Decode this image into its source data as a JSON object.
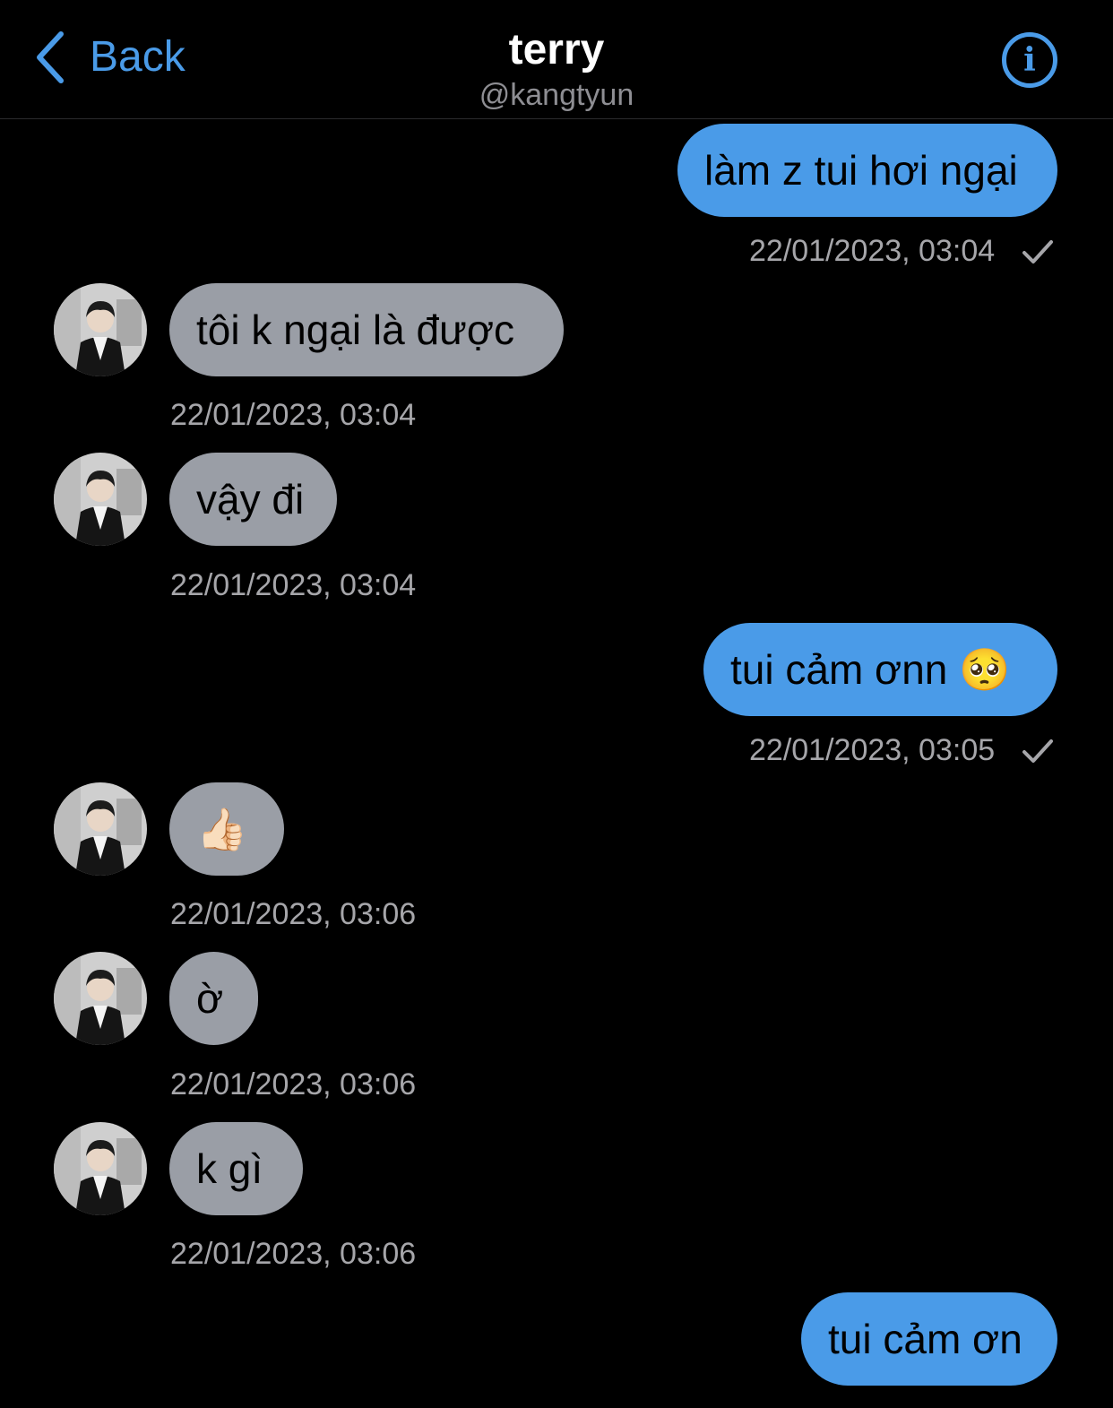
{
  "header": {
    "back_label": "Back",
    "title": "terry",
    "subtitle": "@kangtyun",
    "info_glyph": "i"
  },
  "colors": {
    "accent": "#4a9be8",
    "outgoing_bubble": "#4a9be8",
    "incoming_bubble": "#9a9ea6",
    "background": "#000000",
    "timestamp": "#a6a6aa"
  },
  "messages": [
    {
      "direction": "outgoing",
      "text": "làm z tui hơi ngại",
      "timestamp": "22/01/2023, 03:04",
      "read": true
    },
    {
      "direction": "incoming",
      "text": "tôi k ngại là được",
      "timestamp": "22/01/2023, 03:04"
    },
    {
      "direction": "incoming",
      "text": "vậy đi",
      "timestamp": "22/01/2023, 03:04"
    },
    {
      "direction": "outgoing",
      "text": "tui cảm ơnn 🥺",
      "timestamp": "22/01/2023, 03:05",
      "read": true
    },
    {
      "direction": "incoming",
      "text": "👍🏻",
      "timestamp": "22/01/2023, 03:06"
    },
    {
      "direction": "incoming",
      "text": "ờ",
      "timestamp": "22/01/2023, 03:06"
    },
    {
      "direction": "incoming",
      "text": "k gì",
      "timestamp": "22/01/2023, 03:06"
    },
    {
      "direction": "outgoing",
      "text": "tui cảm ơn"
    }
  ]
}
